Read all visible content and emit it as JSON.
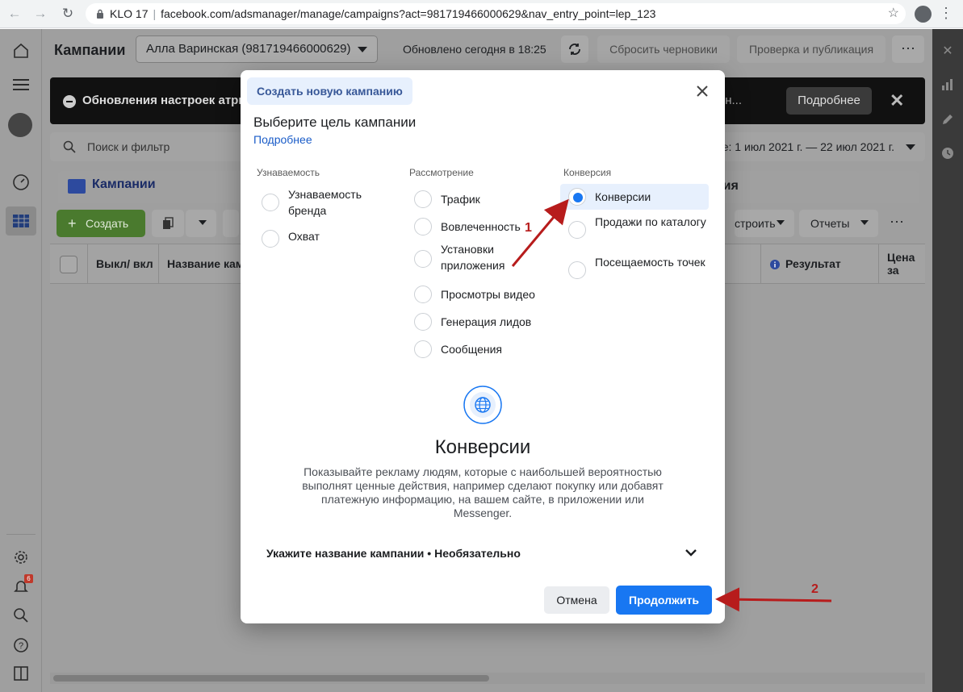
{
  "browser": {
    "tab_title": "KLO 17",
    "url": "facebook.com/adsmanager/manage/campaigns?act=981719466000629&nav_entry_point=lep_123"
  },
  "header": {
    "title": "Кампании",
    "account": "Алла Варинская (981719466000629)",
    "updated": "Обновлено сегодня в 18:25",
    "discard_label": "Сбросить черновики",
    "publish_label": "Проверка и публикация"
  },
  "banner": {
    "text": "Обновления настроек атрибу",
    "text_right": "я измен...",
    "more_label": "Подробнее"
  },
  "search": {
    "placeholder": "Поиск и фильтр",
    "date_range": "е: 1 июл 2021 г. — 22 июл 2021 г."
  },
  "tabs": {
    "campaigns": "Кампании",
    "ads_partial": "ния"
  },
  "toolbar": {
    "create_label": "Создать",
    "configure_label": "строить",
    "reports_label": "Отчеты"
  },
  "table": {
    "columns": [
      "Выкл/ вкл",
      "Название камп",
      "Результат",
      "Цена за"
    ]
  },
  "leftnav": {
    "notif_count": "6"
  },
  "modal": {
    "header_tab": "Создать новую кампанию",
    "heading": "Выберите цель кампании",
    "learn_more": "Подробнее",
    "columns": [
      {
        "caption": "Узнаваемость",
        "options": [
          "Узнаваемость бренда",
          "Охват"
        ]
      },
      {
        "caption": "Рассмотрение",
        "options": [
          "Трафик",
          "Вовлеченность",
          "Установки приложения",
          "Просмотры видео",
          "Генерация лидов",
          "Сообщения"
        ]
      },
      {
        "caption": "Конверсия",
        "options": [
          "Конверсии",
          "Продажи по каталогу",
          "Посещаемость точек"
        ]
      }
    ],
    "selected": "Конверсии",
    "detail_title": "Конверсии",
    "detail_desc": "Показывайте рекламу людям, которые с наибольшей вероятностью выполнят ценные действия, например сделают покупку или добавят платежную информацию, на вашем сайте, в приложении или Messenger.",
    "campaign_name_row": "Укажите название кампании • Необязательно",
    "cancel_label": "Отмена",
    "continue_label": "Продолжить"
  },
  "annotations": {
    "step1": "1",
    "step2": "2",
    "color": "#b71c1c"
  }
}
